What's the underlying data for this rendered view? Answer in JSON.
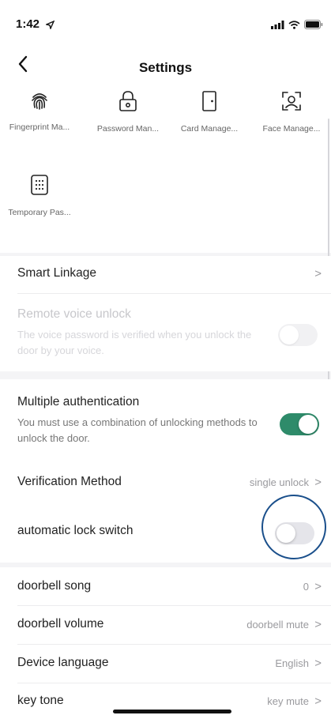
{
  "status_bar": {
    "time": "1:42",
    "icons": [
      "location-arrow-icon",
      "signal-icon",
      "wifi-icon",
      "battery-icon"
    ]
  },
  "header": {
    "title": "Settings",
    "back_icon": "chevron-left-icon"
  },
  "tiles": [
    {
      "label": "Fingerprint Ma...",
      "icon": "fingerprint-icon"
    },
    {
      "label": "Password Man...",
      "icon": "padlock-icon"
    },
    {
      "label": "Card Manage...",
      "icon": "door-card-icon"
    },
    {
      "label": "Face Manage...",
      "icon": "face-scan-icon"
    },
    {
      "label": "Temporary Pas...",
      "icon": "keypad-icon"
    }
  ],
  "section1": {
    "smart_linkage": {
      "title": "Smart Linkage",
      "chevron": ">"
    },
    "remote_voice": {
      "title": "Remote voice unlock",
      "desc": "The voice password is verified when you unlock the door by your voice.",
      "toggle": "off",
      "enabled": false
    }
  },
  "section2": {
    "multiple_auth": {
      "title": "Multiple authentication",
      "desc": "You must use a combination of unlocking methods to unlock the door.",
      "toggle": "on"
    },
    "verification": {
      "title": "Verification Method",
      "value": "single unlock",
      "chevron": ">"
    },
    "auto_lock": {
      "title": "automatic lock switch",
      "toggle": "off"
    }
  },
  "section3": {
    "doorbell_song": {
      "title": "doorbell song",
      "value": "0",
      "chevron": ">"
    },
    "doorbell_volume": {
      "title": "doorbell volume",
      "value": "doorbell mute",
      "chevron": ">"
    },
    "device_language": {
      "title": "Device language",
      "value": "English",
      "chevron": ">"
    },
    "key_tone": {
      "title": "key tone",
      "value": "key mute",
      "chevron": ">"
    }
  },
  "colors": {
    "accent": "#2e8b6a",
    "highlight_ring": "#1a4f8b",
    "background": "#f4f4f6"
  }
}
